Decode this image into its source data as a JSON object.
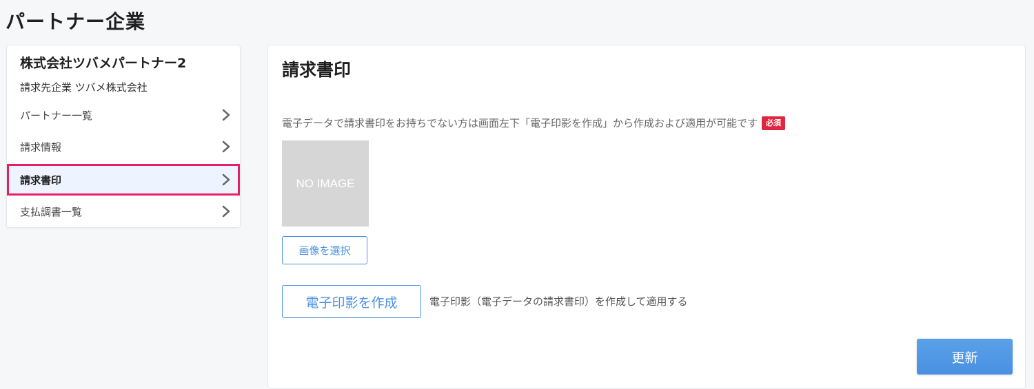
{
  "page": {
    "title": "パートナー企業"
  },
  "sidebar": {
    "company_name": "株式会社ツバメパートナー2",
    "billing_company": "請求先企業 ツバメ株式会社",
    "items": [
      {
        "label": "パートナー一覧",
        "icon": "chevron-right-icon"
      },
      {
        "label": "請求情報",
        "icon": "chevron-right-icon"
      },
      {
        "label": "請求書印",
        "icon": "chevron-right-icon",
        "active": true
      },
      {
        "label": "支払調書一覧",
        "icon": "chevron-right-icon"
      }
    ]
  },
  "main": {
    "section_title": "請求書印",
    "description": "電子データで請求書印をお持ちでない方は画面左下「電子印影を作成」から作成および適用が可能です",
    "required_badge": "必須",
    "image_placeholder": "NO IMAGE",
    "select_image_label": "画像を選択",
    "create_seal_label": "電子印影を作成",
    "create_seal_description": "電子印影（電子データの請求書印）を作成して適用する",
    "update_label": "更新"
  },
  "colors": {
    "accent": "#4a90e2",
    "required": "#e0263f",
    "highlight_outline": "#e91e63",
    "active_bg": "#eef4ff"
  }
}
